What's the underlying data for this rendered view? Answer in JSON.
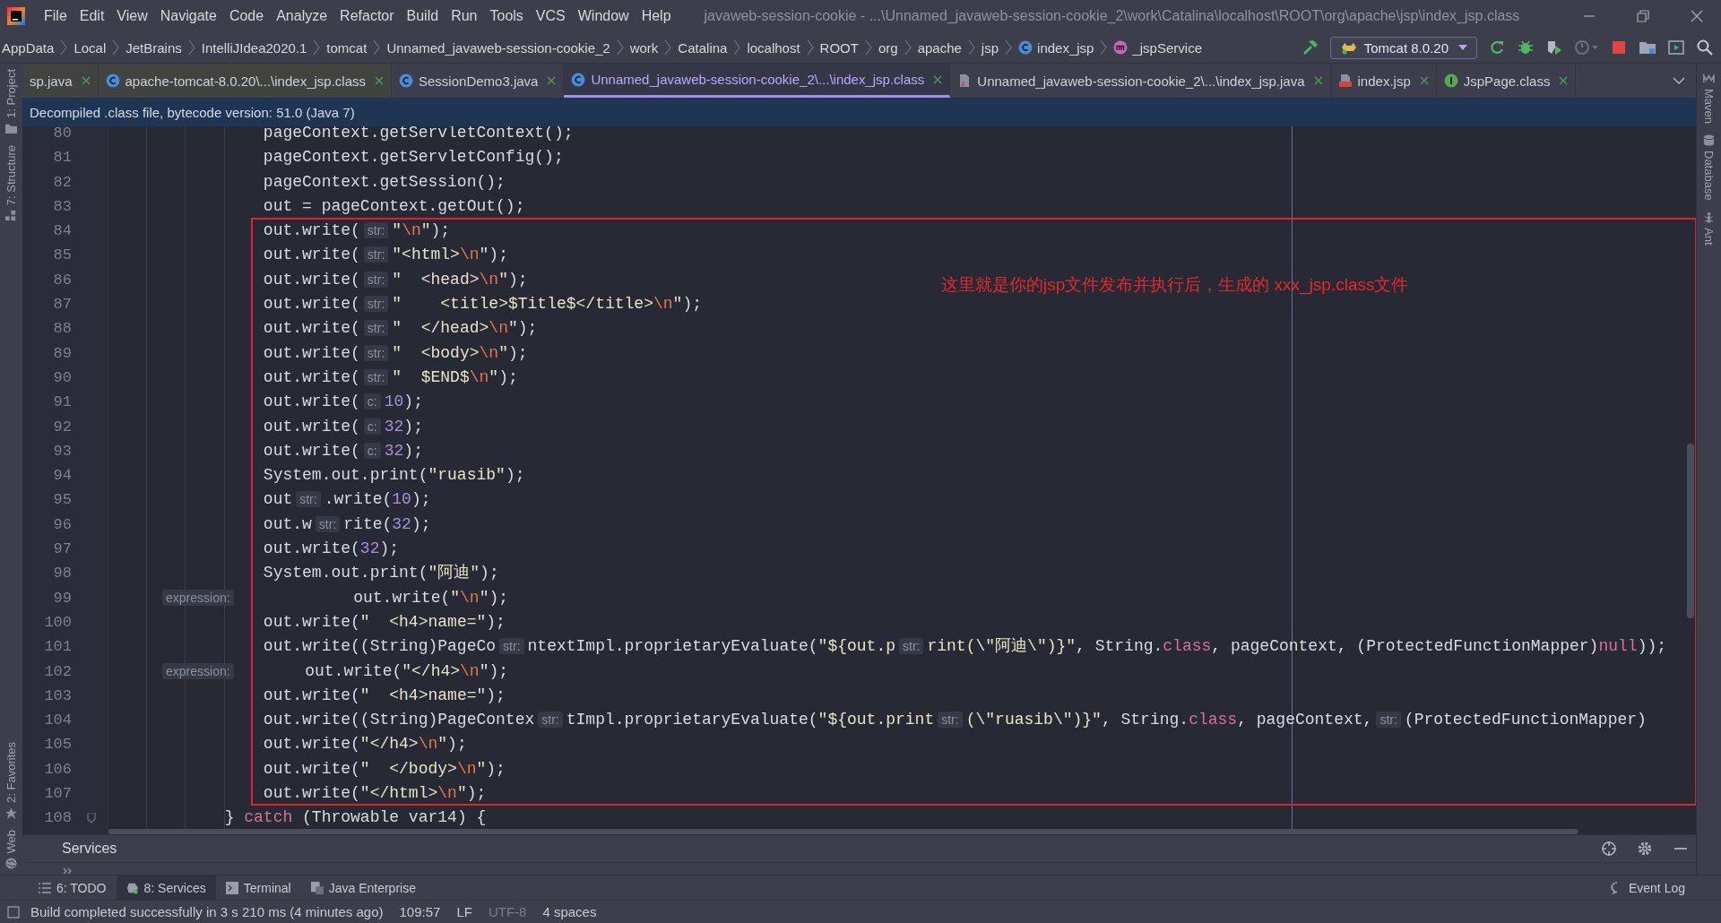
{
  "window": {
    "title": "javaweb-session-cookie - ...\\Unnamed_javaweb-session-cookie_2\\work\\Catalina\\localhost\\ROOT\\org\\apache\\jsp\\index_jsp.class"
  },
  "menu": [
    "File",
    "Edit",
    "View",
    "Navigate",
    "Code",
    "Analyze",
    "Refactor",
    "Build",
    "Run",
    "Tools",
    "VCS",
    "Window",
    "Help"
  ],
  "breadcrumbs": [
    {
      "label": "AppData"
    },
    {
      "label": "Local"
    },
    {
      "label": "JetBrains"
    },
    {
      "label": "IntelliJIdea2020.1"
    },
    {
      "label": "tomcat"
    },
    {
      "label": "Unnamed_javaweb-session-cookie_2"
    },
    {
      "label": "work"
    },
    {
      "label": "Catalina"
    },
    {
      "label": "localhost"
    },
    {
      "label": "ROOT"
    },
    {
      "label": "org"
    },
    {
      "label": "apache"
    },
    {
      "label": "jsp"
    },
    {
      "label": "index_jsp",
      "kind": "class"
    },
    {
      "label": "_jspService",
      "kind": "method"
    }
  ],
  "run_config": "Tomcat 8.0.20",
  "tabs": [
    {
      "label": "sp.java",
      "kind": "plain",
      "selected": false
    },
    {
      "label": "apache-tomcat-8.0.20\\...\\index_jsp.class",
      "kind": "class",
      "selected": false
    },
    {
      "label": "SessionDemo3.java",
      "kind": "class",
      "selected": false
    },
    {
      "label": "Unnamed_javaweb-session-cookie_2\\...\\index_jsp.class",
      "kind": "class",
      "selected": true
    },
    {
      "label": "Unnamed_javaweb-session-cookie_2\\...\\index_jsp.java",
      "kind": "java",
      "selected": false
    },
    {
      "label": "index.jsp",
      "kind": "jsp",
      "selected": false
    },
    {
      "label": "JspPage.class",
      "kind": "interface",
      "selected": false
    }
  ],
  "banner": "Decompiled .class file, bytecode version: 51.0 (Java 7)",
  "editor": {
    "annotation": "这里就是你的jsp文件发布并执行后，生成的 xxx_jsp.class文件",
    "lines": [
      {
        "number": "80",
        "segments": [
          {
            "kind": "code",
            "tokens": [
              {
                "kind": "plain",
                "text": "                pageContext.getServletContext();"
              }
            ]
          }
        ]
      },
      {
        "number": "81",
        "segments": [
          {
            "kind": "code",
            "tokens": [
              {
                "kind": "plain",
                "text": "                pageContext.getServletConfig();"
              }
            ]
          }
        ]
      },
      {
        "number": "82",
        "segments": [
          {
            "kind": "code",
            "tokens": [
              {
                "kind": "plain",
                "text": "                pageContext.getSession();"
              }
            ]
          }
        ]
      },
      {
        "number": "83",
        "segments": [
          {
            "kind": "code",
            "tokens": [
              {
                "kind": "plain",
                "text": "                out = pageContext.getOut();"
              }
            ]
          }
        ]
      },
      {
        "number": "84",
        "segments": [
          {
            "kind": "code",
            "tokens": [
              {
                "kind": "plain",
                "text": "                out.write("
              }
            ]
          },
          {
            "kind": "hint",
            "text": "str:"
          },
          {
            "kind": "code",
            "tokens": [
              {
                "kind": "string",
                "text": "\""
              },
              {
                "kind": "escape",
                "text": "\\n"
              },
              {
                "kind": "string",
                "text": "\""
              },
              {
                "kind": "plain",
                "text": ");"
              }
            ]
          }
        ]
      },
      {
        "number": "85",
        "segments": [
          {
            "kind": "code",
            "tokens": [
              {
                "kind": "plain",
                "text": "                out.write("
              }
            ]
          },
          {
            "kind": "hint",
            "text": "str:"
          },
          {
            "kind": "code",
            "tokens": [
              {
                "kind": "string",
                "text": "\"<html>"
              },
              {
                "kind": "escape",
                "text": "\\n"
              },
              {
                "kind": "string",
                "text": "\""
              },
              {
                "kind": "plain",
                "text": ");"
              }
            ]
          }
        ]
      },
      {
        "number": "86",
        "segments": [
          {
            "kind": "code",
            "tokens": [
              {
                "kind": "plain",
                "text": "                out.write("
              }
            ]
          },
          {
            "kind": "hint",
            "text": "str:"
          },
          {
            "kind": "code",
            "tokens": [
              {
                "kind": "string",
                "text": "\"  <head>"
              },
              {
                "kind": "escape",
                "text": "\\n"
              },
              {
                "kind": "string",
                "text": "\""
              },
              {
                "kind": "plain",
                "text": ");"
              }
            ]
          }
        ]
      },
      {
        "number": "87",
        "segments": [
          {
            "kind": "code",
            "tokens": [
              {
                "kind": "plain",
                "text": "                out.write("
              }
            ]
          },
          {
            "kind": "hint",
            "text": "str:"
          },
          {
            "kind": "code",
            "tokens": [
              {
                "kind": "string",
                "text": "\"    <title>$Title$</title>"
              },
              {
                "kind": "escape",
                "text": "\\n"
              },
              {
                "kind": "string",
                "text": "\""
              },
              {
                "kind": "plain",
                "text": ");"
              }
            ]
          }
        ]
      },
      {
        "number": "88",
        "segments": [
          {
            "kind": "code",
            "tokens": [
              {
                "kind": "plain",
                "text": "                out.write("
              }
            ]
          },
          {
            "kind": "hint",
            "text": "str:"
          },
          {
            "kind": "code",
            "tokens": [
              {
                "kind": "string",
                "text": "\"  </head>"
              },
              {
                "kind": "escape",
                "text": "\\n"
              },
              {
                "kind": "string",
                "text": "\""
              },
              {
                "kind": "plain",
                "text": ");"
              }
            ]
          }
        ]
      },
      {
        "number": "89",
        "segments": [
          {
            "kind": "code",
            "tokens": [
              {
                "kind": "plain",
                "text": "                out.write("
              }
            ]
          },
          {
            "kind": "hint",
            "text": "str:"
          },
          {
            "kind": "code",
            "tokens": [
              {
                "kind": "string",
                "text": "\"  <body>"
              },
              {
                "kind": "escape",
                "text": "\\n"
              },
              {
                "kind": "string",
                "text": "\""
              },
              {
                "kind": "plain",
                "text": ");"
              }
            ]
          }
        ]
      },
      {
        "number": "90",
        "segments": [
          {
            "kind": "code",
            "tokens": [
              {
                "kind": "plain",
                "text": "                out.write("
              }
            ]
          },
          {
            "kind": "hint",
            "text": "str:"
          },
          {
            "kind": "code",
            "tokens": [
              {
                "kind": "string",
                "text": "\"  $END$"
              },
              {
                "kind": "escape",
                "text": "\\n"
              },
              {
                "kind": "string",
                "text": "\""
              },
              {
                "kind": "plain",
                "text": ");"
              }
            ]
          }
        ]
      },
      {
        "number": "91",
        "segments": [
          {
            "kind": "code",
            "tokens": [
              {
                "kind": "plain",
                "text": "                out.write("
              }
            ]
          },
          {
            "kind": "hint",
            "text": "c:"
          },
          {
            "kind": "code",
            "tokens": [
              {
                "kind": "number",
                "text": "10"
              },
              {
                "kind": "plain",
                "text": ");"
              }
            ]
          }
        ]
      },
      {
        "number": "92",
        "segments": [
          {
            "kind": "code",
            "tokens": [
              {
                "kind": "plain",
                "text": "                out.write("
              }
            ]
          },
          {
            "kind": "hint",
            "text": "c:"
          },
          {
            "kind": "code",
            "tokens": [
              {
                "kind": "number",
                "text": "32"
              },
              {
                "kind": "plain",
                "text": ");"
              }
            ]
          }
        ]
      },
      {
        "number": "93",
        "segments": [
          {
            "kind": "code",
            "tokens": [
              {
                "kind": "plain",
                "text": "                out.write("
              }
            ]
          },
          {
            "kind": "hint",
            "text": "c:"
          },
          {
            "kind": "code",
            "tokens": [
              {
                "kind": "number",
                "text": "32"
              },
              {
                "kind": "plain",
                "text": ");"
              }
            ]
          }
        ]
      },
      {
        "number": "94",
        "segments": [
          {
            "kind": "code",
            "tokens": [
              {
                "kind": "plain",
                "text": "                System.out.print("
              },
              {
                "kind": "string",
                "text": "\"ruasib\""
              },
              {
                "kind": "plain",
                "text": ");"
              }
            ]
          }
        ]
      },
      {
        "number": "95",
        "segments": [
          {
            "kind": "code",
            "tokens": [
              {
                "kind": "plain",
                "text": "                out"
              }
            ]
          },
          {
            "kind": "hint",
            "text": "str:"
          },
          {
            "kind": "code",
            "tokens": [
              {
                "kind": "plain",
                "text": ".write("
              },
              {
                "kind": "number",
                "text": "10"
              },
              {
                "kind": "plain",
                "text": ");"
              }
            ]
          }
        ]
      },
      {
        "number": "96",
        "segments": [
          {
            "kind": "code",
            "tokens": [
              {
                "kind": "plain",
                "text": "                out.w"
              }
            ]
          },
          {
            "kind": "hint",
            "text": "str:"
          },
          {
            "kind": "code",
            "tokens": [
              {
                "kind": "plain",
                "text": "rite("
              },
              {
                "kind": "number",
                "text": "32"
              },
              {
                "kind": "plain",
                "text": ");"
              }
            ]
          }
        ]
      },
      {
        "number": "97",
        "segments": [
          {
            "kind": "code",
            "tokens": [
              {
                "kind": "plain",
                "text": "                out.write("
              },
              {
                "kind": "number",
                "text": "32"
              },
              {
                "kind": "plain",
                "text": ");"
              }
            ]
          }
        ]
      },
      {
        "number": "98",
        "segments": [
          {
            "kind": "code",
            "tokens": [
              {
                "kind": "plain",
                "text": "                System.out.print("
              },
              {
                "kind": "string",
                "text": "\"阿迪\""
              },
              {
                "kind": "plain",
                "text": ");"
              }
            ]
          }
        ]
      },
      {
        "number": "99",
        "segments": [
          {
            "kind": "hint",
            "text": "expression:"
          },
          {
            "kind": "code",
            "tokens": [
              {
                "kind": "plain",
                "text": "            out.write("
              },
              {
                "kind": "string",
                "text": "\""
              },
              {
                "kind": "escape",
                "text": "\\n"
              },
              {
                "kind": "string",
                "text": "\""
              },
              {
                "kind": "plain",
                "text": ");"
              }
            ]
          }
        ]
      },
      {
        "number": "100",
        "segments": [
          {
            "kind": "code",
            "tokens": [
              {
                "kind": "plain",
                "text": "                out.write("
              },
              {
                "kind": "string",
                "text": "\"  <h4>name=\""
              },
              {
                "kind": "plain",
                "text": ");"
              }
            ]
          }
        ]
      },
      {
        "number": "101",
        "segments": [
          {
            "kind": "code",
            "tokens": [
              {
                "kind": "plain",
                "text": "                out.write((String)PageCo"
              }
            ]
          },
          {
            "kind": "hint",
            "text": "str:"
          },
          {
            "kind": "code",
            "tokens": [
              {
                "kind": "plain",
                "text": "ntextImpl.proprietaryEvaluate("
              },
              {
                "kind": "string",
                "text": "\"${out.p"
              }
            ]
          },
          {
            "kind": "hint",
            "text": "str:"
          },
          {
            "kind": "code",
            "tokens": [
              {
                "kind": "string",
                "text": "rint(\\\"阿迪\\\")}\""
              },
              {
                "kind": "plain",
                "text": ", String."
              },
              {
                "kind": "keyword",
                "text": "class"
              },
              {
                "kind": "plain",
                "text": ", pageContext, (ProtectedFunctionMapper)"
              },
              {
                "kind": "keyword",
                "text": "null"
              },
              {
                "kind": "plain",
                "text": "));"
              }
            ]
          }
        ]
      },
      {
        "number": "102",
        "segments": [
          {
            "kind": "hint",
            "text": "expression:"
          },
          {
            "kind": "code",
            "tokens": [
              {
                "kind": "plain",
                "text": "       out.write("
              },
              {
                "kind": "string",
                "text": "\"</h4>"
              },
              {
                "kind": "escape",
                "text": "\\n"
              },
              {
                "kind": "string",
                "text": "\""
              },
              {
                "kind": "plain",
                "text": ");"
              }
            ]
          }
        ]
      },
      {
        "number": "103",
        "segments": [
          {
            "kind": "code",
            "tokens": [
              {
                "kind": "plain",
                "text": "                out.write("
              },
              {
                "kind": "string",
                "text": "\"  <h4>name=\""
              },
              {
                "kind": "plain",
                "text": ");"
              }
            ]
          }
        ]
      },
      {
        "number": "104",
        "segments": [
          {
            "kind": "code",
            "tokens": [
              {
                "kind": "plain",
                "text": "                out.write((String)PageContex"
              }
            ]
          },
          {
            "kind": "hint",
            "text": "str:"
          },
          {
            "kind": "code",
            "tokens": [
              {
                "kind": "plain",
                "text": "tImpl.proprietaryEvaluate("
              },
              {
                "kind": "string",
                "text": "\"${out.print"
              }
            ]
          },
          {
            "kind": "hint",
            "text": "str:"
          },
          {
            "kind": "code",
            "tokens": [
              {
                "kind": "string",
                "text": "(\\\"ruasib\\\")}\""
              },
              {
                "kind": "plain",
                "text": ", String."
              },
              {
                "kind": "keyword",
                "text": "class"
              },
              {
                "kind": "plain",
                "text": ", pageContext,"
              }
            ]
          },
          {
            "kind": "hint",
            "text": "str:"
          },
          {
            "kind": "code",
            "tokens": [
              {
                "kind": "plain",
                "text": "(ProtectedFunctionMapper)"
              }
            ]
          }
        ]
      },
      {
        "number": "105",
        "segments": [
          {
            "kind": "code",
            "tokens": [
              {
                "kind": "plain",
                "text": "                out.write("
              },
              {
                "kind": "string",
                "text": "\"</h4>"
              },
              {
                "kind": "escape",
                "text": "\\n"
              },
              {
                "kind": "string",
                "text": "\""
              },
              {
                "kind": "plain",
                "text": ");"
              }
            ]
          }
        ]
      },
      {
        "number": "106",
        "segments": [
          {
            "kind": "code",
            "tokens": [
              {
                "kind": "plain",
                "text": "                out.write("
              },
              {
                "kind": "string",
                "text": "\"  </body>"
              },
              {
                "kind": "escape",
                "text": "\\n"
              },
              {
                "kind": "string",
                "text": "\""
              },
              {
                "kind": "plain",
                "text": ");"
              }
            ]
          }
        ]
      },
      {
        "number": "107",
        "segments": [
          {
            "kind": "code",
            "tokens": [
              {
                "kind": "plain",
                "text": "                out.write("
              },
              {
                "kind": "string",
                "text": "\"</html>"
              },
              {
                "kind": "escape",
                "text": "\\n"
              },
              {
                "kind": "string",
                "text": "\""
              },
              {
                "kind": "plain",
                "text": ");"
              }
            ]
          }
        ]
      },
      {
        "number": "108",
        "segments": [
          {
            "kind": "code",
            "tokens": [
              {
                "kind": "plain",
                "text": "            } "
              },
              {
                "kind": "keyword",
                "text": "catch"
              },
              {
                "kind": "plain",
                "text": " (Throwable var14) {"
              }
            ]
          }
        ]
      }
    ]
  },
  "left_tool_strip": [
    {
      "label": "1: Project",
      "kind": "folder"
    },
    {
      "label": "7: Structure",
      "kind": "structure"
    },
    {
      "label": "2: Favorites",
      "kind": "star"
    },
    {
      "label": "Web",
      "kind": "globe"
    }
  ],
  "right_tool_strip": [
    {
      "label": "Maven",
      "kind": "maven"
    },
    {
      "label": "Database",
      "kind": "database"
    },
    {
      "label": "Ant",
      "kind": "ant"
    }
  ],
  "services_panel": {
    "title": "Services"
  },
  "tool_windows": [
    {
      "label": "6: TODO",
      "kind": "list",
      "selected": false
    },
    {
      "label": "8: Services",
      "kind": "services",
      "selected": true
    },
    {
      "label": "Terminal",
      "kind": "terminal",
      "selected": false
    },
    {
      "label": "Java Enterprise",
      "kind": "enterprise",
      "selected": false
    }
  ],
  "event_log": "Event Log",
  "status_bar": {
    "message": "Build completed successfully in 3 s 210 ms (4 minutes ago)",
    "items": [
      {
        "text": "109:57",
        "disabled": false
      },
      {
        "text": "LF",
        "disabled": false
      },
      {
        "text": "UTF-8",
        "disabled": true
      },
      {
        "text": "4 spaces",
        "disabled": false
      }
    ]
  }
}
